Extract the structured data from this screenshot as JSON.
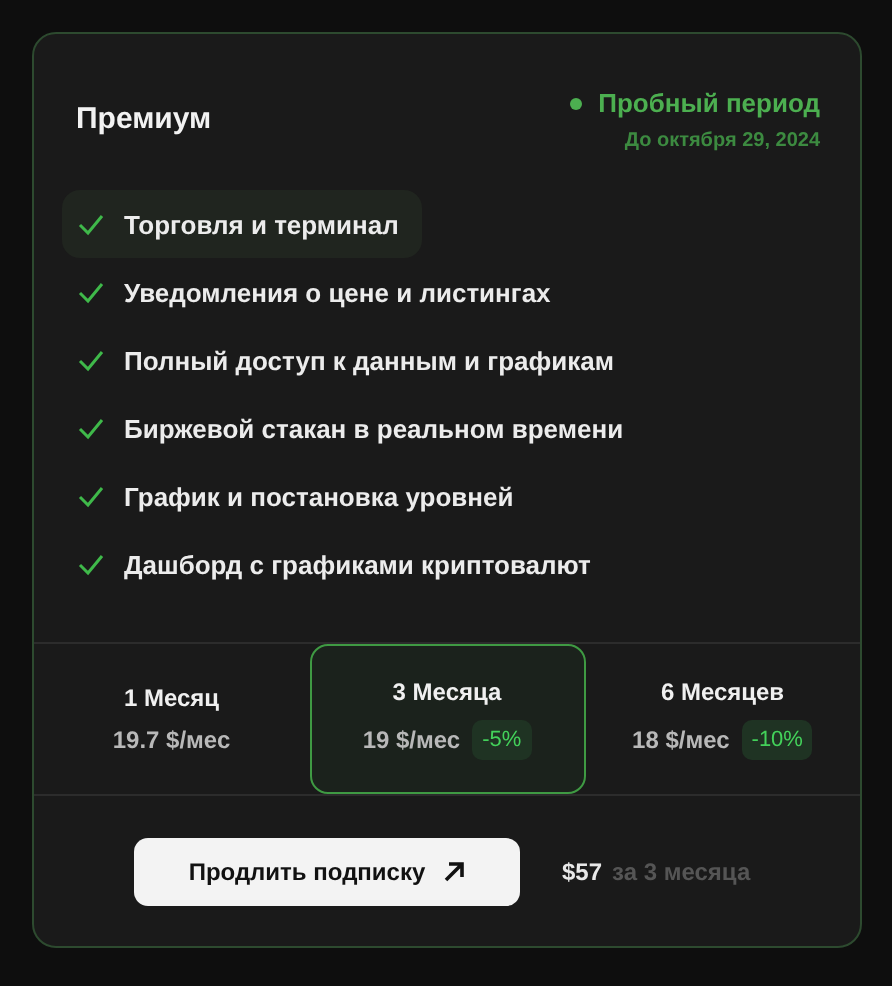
{
  "plan": {
    "title": "Премиум",
    "status": "Пробный период",
    "until": "До октября 29, 2024"
  },
  "features": [
    {
      "label": "Торговля и терминал",
      "highlighted": true
    },
    {
      "label": "Уведомления о цене и листингах",
      "highlighted": false
    },
    {
      "label": "Полный доступ к данным и графикам",
      "highlighted": false
    },
    {
      "label": "Биржевой стакан в реальном времени",
      "highlighted": false
    },
    {
      "label": "График и постановка уровней",
      "highlighted": false
    },
    {
      "label": "Дашборд с графиками криптовалют",
      "highlighted": false
    }
  ],
  "periods": [
    {
      "label": "1 Месяц",
      "price": "19.7 $/мес",
      "selected": false
    },
    {
      "label": "3 Месяца",
      "price": "19 $/мес",
      "discount": "-5%",
      "selected": true
    },
    {
      "label": "6 Месяцев",
      "price": "18 $/мес",
      "discount": "-10%",
      "selected": false
    }
  ],
  "footer": {
    "button": "Продлить подписку",
    "total": "$57",
    "total_note": "за 3 месяца"
  }
}
